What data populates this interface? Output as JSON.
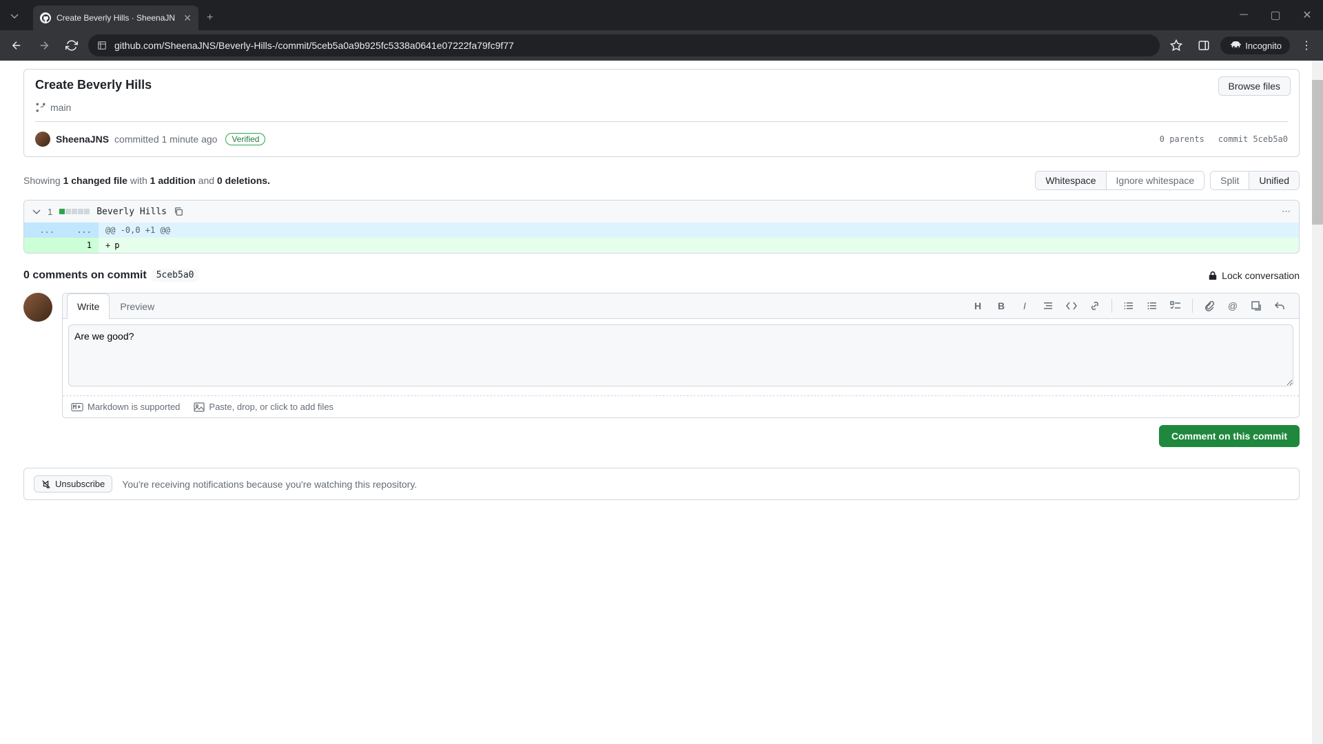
{
  "browser": {
    "tab_title": "Create Beverly Hills · SheenaJN",
    "url": "github.com/SheenaJNS/Beverly-Hills-/commit/5ceb5a0a9b925fc5338a0641e07222fa79fc9f77",
    "incognito_label": "Incognito"
  },
  "commit": {
    "title": "Create Beverly Hills",
    "branch": "main",
    "browse_files": "Browse files",
    "author": "SheenaJNS",
    "committed_text": "committed 1 minute ago",
    "verified": "Verified",
    "parents": "0 parents",
    "commit_label": "commit",
    "sha": "5ceb5a0"
  },
  "stats": {
    "showing": "Showing",
    "changed": "1 changed file",
    "with": "with",
    "additions": "1 addition",
    "and": "and",
    "deletions": "0 deletions."
  },
  "view_options": {
    "whitespace": "Whitespace",
    "ignore_whitespace": "Ignore whitespace",
    "split": "Split",
    "unified": "Unified"
  },
  "diff": {
    "count": "1",
    "filename": "Beverly Hills",
    "hunk": "@@ -0,0 +1 @@",
    "add_line_num": "1",
    "add_content": "p",
    "expand_dots": "..."
  },
  "comments": {
    "title_prefix": "0 comments on commit",
    "sha": "5ceb5a0",
    "lock": "Lock conversation",
    "write_tab": "Write",
    "preview_tab": "Preview",
    "textarea_value": "Are we good?",
    "markdown_supported": "Markdown is supported",
    "paste_drop": "Paste, drop, or click to add files",
    "submit": "Comment on this commit"
  },
  "subscribe": {
    "button": "Unsubscribe",
    "text": "You're receiving notifications because you're watching this repository."
  }
}
